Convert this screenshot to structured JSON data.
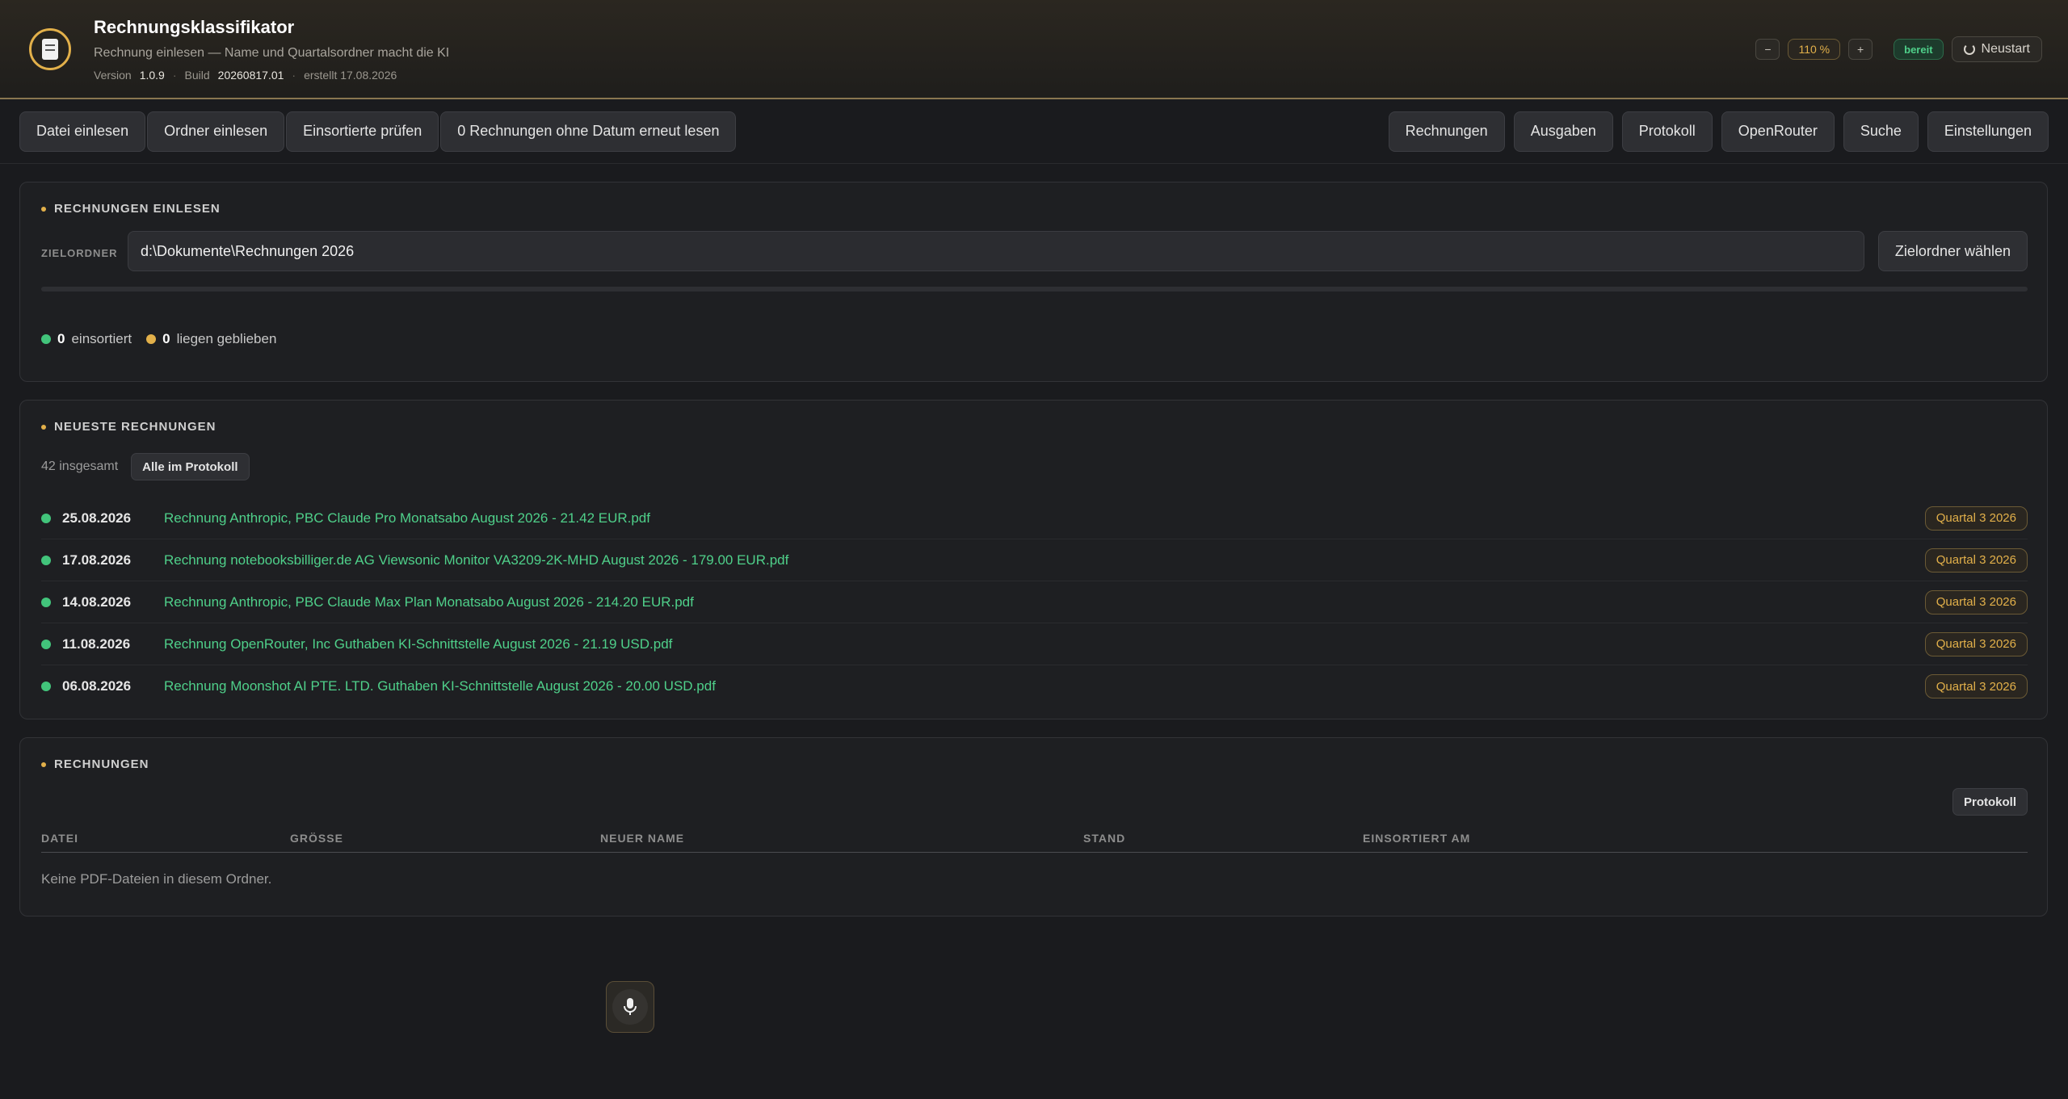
{
  "header": {
    "title": "Rechnungsklassifikator",
    "subtitle": "Rechnung einlesen — Name und Quartalsordner macht die KI",
    "version_label": "Version",
    "version": "1.0.9",
    "build_label": "Build",
    "build": "20260817.01",
    "created": "erstellt 17.08.2026",
    "zoom_minus": "−",
    "zoom_value": "110 %",
    "zoom_plus": "+",
    "status": "bereit",
    "restart": "Neustart",
    "colors": {
      "accent": "#e2b04a",
      "status_ok": "#4fd08a"
    }
  },
  "toolbar": {
    "left": [
      "Datei einlesen",
      "Ordner einlesen",
      "Einsortierte prüfen",
      "0 Rechnungen ohne Datum erneut lesen"
    ],
    "right": [
      "Rechnungen",
      "Ausgaben",
      "Protokoll",
      "OpenRouter",
      "Suche",
      "Einstellungen"
    ]
  },
  "import_panel": {
    "title": "RECHNUNGEN EINLESEN",
    "target_label": "ZIELORDNER",
    "target_value": "d:\\Dokumente\\Rechnungen 2026",
    "choose_button": "Zielordner wählen",
    "progress": 0,
    "sorted_count": "0",
    "sorted_label": "einsortiert",
    "remaining_count": "0",
    "remaining_label": "liegen geblieben"
  },
  "recent_panel": {
    "title": "NEUESTE RECHNUNGEN",
    "total": "42 insgesamt",
    "all_button": "Alle im Protokoll",
    "items": [
      {
        "date": "25.08.2026",
        "name": "Rechnung Anthropic, PBC Claude Pro Monatsabo August 2026 - 21.42 EUR.pdf",
        "quarter": "Quartal 3 2026"
      },
      {
        "date": "17.08.2026",
        "name": "Rechnung notebooksbilliger.de AG Viewsonic Monitor VA3209-2K-MHD August 2026 - 179.00 EUR.pdf",
        "quarter": "Quartal 3 2026"
      },
      {
        "date": "14.08.2026",
        "name": "Rechnung Anthropic, PBC Claude Max Plan Monatsabo August 2026 - 214.20 EUR.pdf",
        "quarter": "Quartal 3 2026"
      },
      {
        "date": "11.08.2026",
        "name": "Rechnung OpenRouter, Inc Guthaben KI-Schnittstelle August 2026 - 21.19 USD.pdf",
        "quarter": "Quartal 3 2026"
      },
      {
        "date": "06.08.2026",
        "name": "Rechnung Moonshot AI PTE. LTD. Guthaben KI-Schnittstelle August 2026 - 20.00 USD.pdf",
        "quarter": "Quartal 3 2026"
      }
    ]
  },
  "files_panel": {
    "title": "RECHNUNGEN",
    "protocol_button": "Protokoll",
    "columns": [
      "DATEI",
      "GRÖSSE",
      "NEUER NAME",
      "STAND",
      "EINSORTIERT AM"
    ],
    "empty": "Keine PDF-Dateien in diesem Ordner."
  },
  "icons": {
    "logo": "invoice-logo-icon",
    "restart": "refresh-icon",
    "mic": "microphone-icon"
  }
}
